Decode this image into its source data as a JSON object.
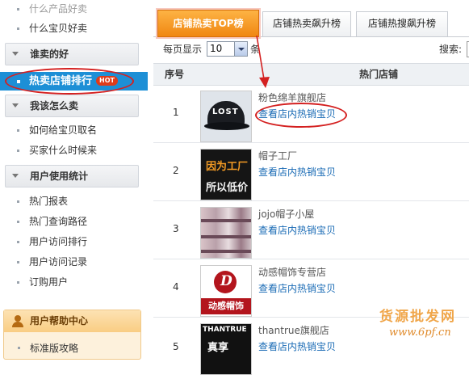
{
  "sidebar": {
    "top_items": [
      "什么产品好卖",
      "什么宝贝好卖"
    ],
    "section1": "谁卖的好",
    "active_item": "热卖店铺排行",
    "hot_badge": "HOT",
    "section2": "我该怎么卖",
    "section2_items": [
      "如何给宝贝取名",
      "买家什么时候来"
    ],
    "section3": "用户使用统计",
    "section3_items": [
      "热门报表",
      "热门查询路径",
      "用户访问排行",
      "用户访问记录",
      "订购用户"
    ],
    "help_title": "用户帮助中心",
    "help_items": [
      "标准版攻略"
    ]
  },
  "tabs": [
    "店铺热卖TOP榜",
    "店铺热卖飙升榜",
    "店铺热搜飙升榜"
  ],
  "toolbar": {
    "per_page_label": "每页显示",
    "per_page_value": "10",
    "per_page_unit": "条",
    "search_label": "搜索:"
  },
  "table": {
    "headers": [
      "序号",
      "热门店铺"
    ],
    "rows": [
      {
        "rank": "1",
        "shop": "粉色绵羊旗舰店",
        "link": "查看店内热销宝贝",
        "thumb_text": "LOST"
      },
      {
        "rank": "2",
        "shop": "帽子工厂",
        "link": "查看店内热销宝贝",
        "thumb_text": [
          "因为工厂",
          "所以低价"
        ]
      },
      {
        "rank": "3",
        "shop": "jojo帽子小屋",
        "link": "查看店内热销宝贝"
      },
      {
        "rank": "4",
        "shop": "动感帽饰专营店",
        "link": "查看店内热销宝贝",
        "thumb_text": [
          "D",
          "动感帽饰"
        ]
      },
      {
        "rank": "5",
        "shop": "thantrue旗舰店",
        "link": "查看店内热销宝贝",
        "thumb_text": [
          "THANTRUE",
          "真享"
        ]
      }
    ]
  },
  "watermark": {
    "line1": "货源批发网",
    "line2": "www.6pf.cn"
  },
  "colors": {
    "active_blue": "#1d8fd6",
    "tab_orange": "#f08712",
    "link_blue": "#1a6bb5",
    "annotation_red": "#d42020"
  }
}
